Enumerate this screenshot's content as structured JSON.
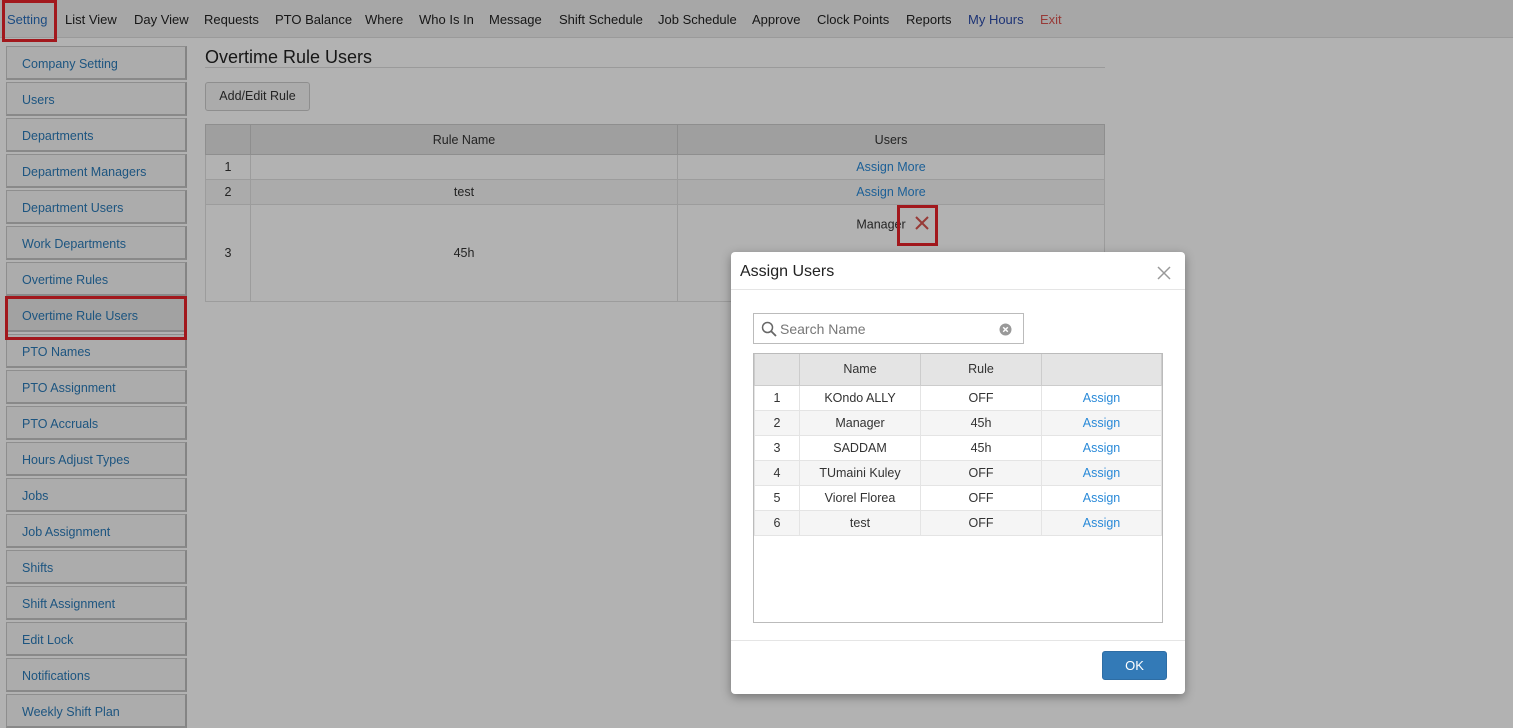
{
  "topnav": {
    "items": [
      "Setting",
      "List View",
      "Day View",
      "Requests",
      "PTO Balance",
      "Where",
      "Who Is In",
      "Message",
      "Shift Schedule",
      "Job Schedule",
      "Approve",
      "Clock Points",
      "Reports",
      "My Hours",
      "Exit"
    ]
  },
  "sidebar": {
    "items": [
      "Company Setting",
      "Users",
      "Departments",
      "Department Managers",
      "Department Users",
      "Work Departments",
      "Overtime Rules",
      "Overtime Rule Users",
      "PTO Names",
      "PTO Assignment",
      "PTO Accruals",
      "Hours Adjust Types",
      "Jobs",
      "Job Assignment",
      "Shifts",
      "Shift Assignment",
      "Edit Lock",
      "Notifications",
      "Weekly Shift Plan"
    ],
    "active": "Overtime Rule Users"
  },
  "main": {
    "title": "Overtime Rule Users",
    "add_edit_button": "Add/Edit Rule",
    "table": {
      "headers": [
        "",
        "Rule Name",
        "Users"
      ],
      "rows": [
        {
          "num": "1",
          "rule": "",
          "users": "Assign More"
        },
        {
          "num": "2",
          "rule": "test",
          "users": "Assign More"
        },
        {
          "num": "3",
          "rule": "45h",
          "users": "Manager"
        }
      ]
    }
  },
  "modal": {
    "title": "Assign Users",
    "search_placeholder": "Search Name",
    "headers": [
      "",
      "Name",
      "Rule",
      ""
    ],
    "rows": [
      {
        "num": "1",
        "name": "KOndo ALLY",
        "rule": "OFF",
        "action": "Assign"
      },
      {
        "num": "2",
        "name": "Manager",
        "rule": "45h",
        "action": "Assign"
      },
      {
        "num": "3",
        "name": "SADDAM",
        "rule": "45h",
        "action": "Assign"
      },
      {
        "num": "4",
        "name": "TUmaini Kuley",
        "rule": "OFF",
        "action": "Assign"
      },
      {
        "num": "5",
        "name": "Viorel Florea",
        "rule": "OFF",
        "action": "Assign"
      },
      {
        "num": "6",
        "name": "test",
        "rule": "OFF",
        "action": "Assign"
      }
    ],
    "ok_button": "OK"
  },
  "colors": {
    "link": "#2a8ad8",
    "highlight": "#e8232a",
    "primary": "#337ab7",
    "exit": "#d9534f"
  },
  "icons": {
    "search": "search-icon",
    "clear": "clear-circle-icon",
    "close": "close-icon",
    "remove": "remove-x-icon"
  }
}
